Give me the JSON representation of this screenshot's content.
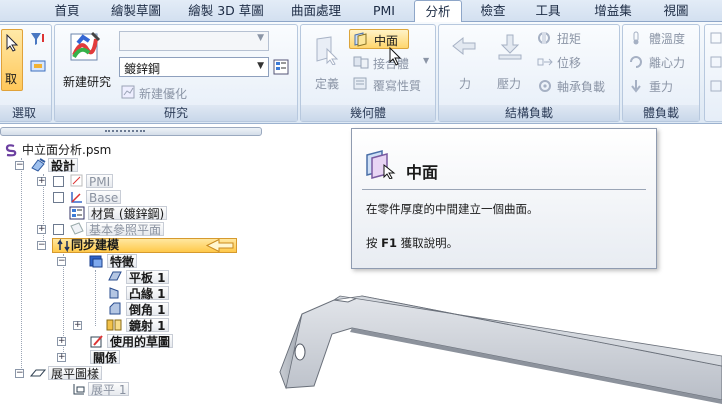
{
  "tabs": [
    "首頁",
    "繪製草圖",
    "繪製 3D 草圖",
    "曲面處理",
    "PMI",
    "分析",
    "檢查",
    "工具",
    "增益集",
    "視圖"
  ],
  "active_tab": "分析",
  "ribbon": {
    "select_group": {
      "title": "選取",
      "select_label": "取"
    },
    "research_group": {
      "title": "研究",
      "new_research": "新建研究",
      "material_dropdown_top": "",
      "material_value": "鍍鋅鋼",
      "new_optimize": "新建優化"
    },
    "geometry_group": {
      "title": "幾何體",
      "define": "定義",
      "midsurface": "中面",
      "contact": "接合體",
      "overwrite": "覆寫性質"
    },
    "load_group": {
      "title": "結構負載",
      "force": "力",
      "pressure": "壓力",
      "torque": "扭矩",
      "displacement": "位移",
      "bearing": "軸承負載"
    },
    "body_load_group": {
      "title": "體負載",
      "temperature": "體溫度",
      "centrifugal": "離心力",
      "gravity": "重力"
    }
  },
  "tree": {
    "root": "中立面分析.psm",
    "design": "設計",
    "pmi": "PMI",
    "base": "Base",
    "material": "材質 (鍍鋅鋼)",
    "ref_planes": "基本參照平面",
    "sync": "同步建模",
    "features": "特徵",
    "f1": "平板 1",
    "f2": "凸緣 1",
    "f3": "倒角 1",
    "f4": "鏡射 1",
    "sketches": "使用的草圖",
    "relations": "關係",
    "flat_pattern": "展平圖樣",
    "flat1": "展平 1"
  },
  "tooltip": {
    "title": "中面",
    "description": "在零件厚度的中間建立一個曲面。",
    "help_prefix": "按 ",
    "help_key": "F1",
    "help_suffix": " 獲取說明。"
  },
  "colors": {
    "ribbon_bg": "#dde8f4",
    "sync_highlight": "#ffd25e",
    "accent": "#f0a020"
  }
}
